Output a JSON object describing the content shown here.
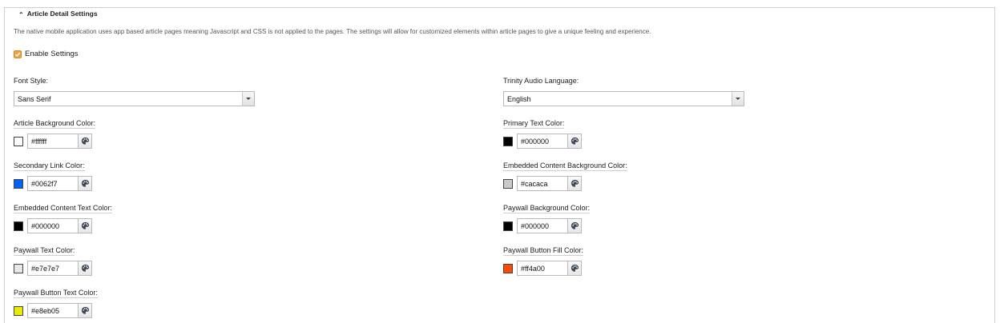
{
  "section": {
    "title": "Article Detail Settings",
    "description": "The native mobile application uses app based article pages meaning Javascript and CSS is not applied to the pages. The settings will allow for customized elements within article pages to give a unique feeling and experience.",
    "enable_label": "Enable Settings",
    "enable_checked": true,
    "checkbox_color": "#f0a23a"
  },
  "font_style": {
    "label": "Font Style:",
    "value": "Sans Serif"
  },
  "trinity_language": {
    "label": "Trinity Audio Language:",
    "value": "English"
  },
  "colors": {
    "article_background": {
      "label": "Article Background Color:",
      "value": "#ffffff",
      "swatch": "#ffffff"
    },
    "primary_text": {
      "label": "Primary Text Color:",
      "value": "#000000",
      "swatch": "#000000"
    },
    "secondary_link": {
      "label": "Secondary Link Color:",
      "value": "#0062f7",
      "swatch": "#0062f7"
    },
    "embedded_background": {
      "label": "Embedded Content Background Color:",
      "value": "#cacaca",
      "swatch": "#cacaca"
    },
    "embedded_text": {
      "label": "Embedded Content Text Color:",
      "value": "#000000",
      "swatch": "#000000"
    },
    "paywall_background": {
      "label": "Paywall Background Color:",
      "value": "#000000",
      "swatch": "#000000"
    },
    "paywall_text": {
      "label": "Paywall Text Color:",
      "value": "#e7e7e7",
      "swatch": "#e7e7e7"
    },
    "paywall_button_fill": {
      "label": "Paywall Button Fill Color:",
      "value": "#ff4a00",
      "swatch": "#ff4a00"
    },
    "paywall_button_text": {
      "label": "Paywall Button Text Color:",
      "value": "#e8eb05",
      "swatch": "#e8eb05"
    }
  },
  "icons": {
    "collapse": "chevron-up-icon",
    "picker": "palette-icon",
    "dropdown": "caret-down-icon"
  }
}
